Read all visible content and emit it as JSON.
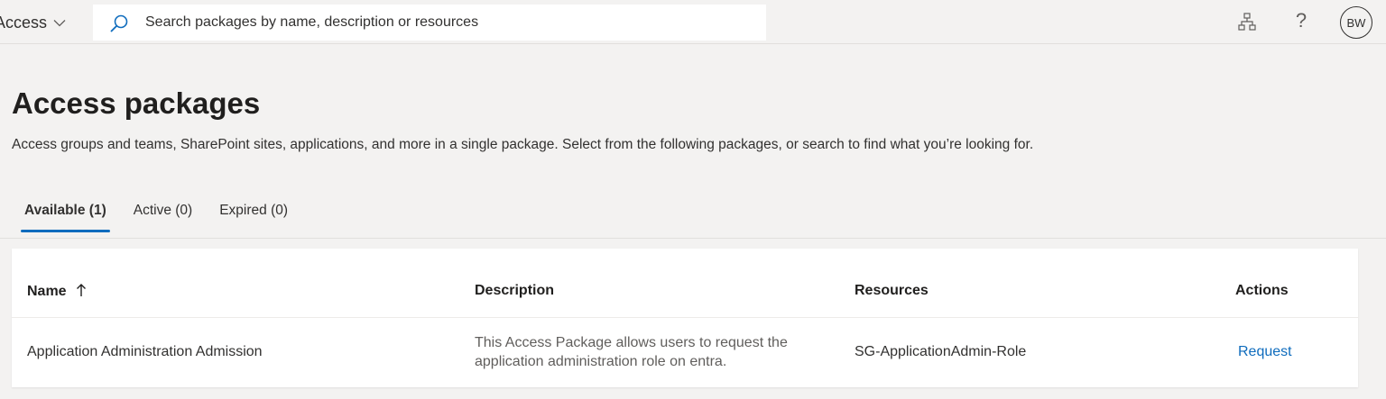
{
  "header": {
    "app_switcher_label": "Access",
    "search_placeholder": "Search packages by name, description or resources",
    "help_glyph": "?",
    "avatar_initials": "BW",
    "icons": [
      "chevron-down-icon",
      "search-icon",
      "org-chart-icon",
      "help-icon"
    ]
  },
  "page": {
    "title": "Access packages",
    "subtitle": "Access groups and teams, SharePoint sites, applications, and more in a single package. Select from the following packages, or search to find what you’re looking for."
  },
  "tabs": [
    {
      "label": "Available (1)",
      "selected": true
    },
    {
      "label": "Active (0)",
      "selected": false
    },
    {
      "label": "Expired (0)",
      "selected": false
    }
  ],
  "table": {
    "columns": {
      "name": "Name",
      "description": "Description",
      "resources": "Resources",
      "actions": "Actions"
    },
    "sort": {
      "column": "Name",
      "direction": "ascending"
    },
    "rows": [
      {
        "name": "Application Administration Admission",
        "description": "This Access Package allows users to request the application administration role on entra.",
        "resources": "SG-ApplicationAdmin-Role",
        "action": "Request"
      }
    ]
  },
  "colors": {
    "accent": "#0f6cbd",
    "background": "#f3f2f1",
    "card": "#ffffff"
  }
}
